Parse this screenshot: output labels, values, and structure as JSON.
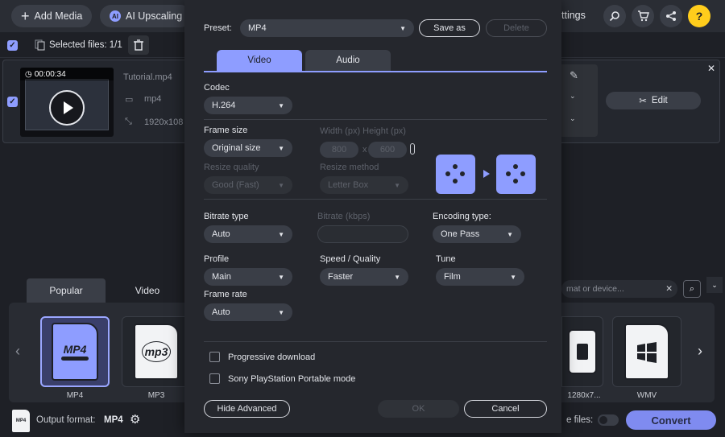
{
  "toolbar": {
    "add_media": "Add Media",
    "ai_upscaling": "AI Upscaling",
    "settings_partial": "ttings"
  },
  "selection": {
    "label": "Selected files: 1/1"
  },
  "file": {
    "duration": "00:00:34",
    "name": "Tutorial.mp4",
    "format": "mp4",
    "resolution": "1920x108",
    "edit_label": "Edit"
  },
  "format_panel": {
    "tabs": [
      "Popular",
      "Video"
    ],
    "search_placeholder": "mat or device...",
    "cards": [
      {
        "label": "MP4",
        "icon_text": "MP4"
      },
      {
        "label": "MP3",
        "icon_text": "mp3"
      },
      {
        "label": "1280x7...",
        "icon_text": ""
      },
      {
        "label": "WMV",
        "icon_text": ""
      }
    ]
  },
  "bottom": {
    "output_label": "Output format:",
    "output_value": "MP4",
    "merge_partial": "e files:",
    "convert_label": "Convert"
  },
  "dialog": {
    "preset_label": "Preset:",
    "preset_value": "MP4",
    "save_as": "Save as",
    "delete": "Delete",
    "tabs": {
      "video": "Video",
      "audio": "Audio"
    },
    "codec_label": "Codec",
    "codec_value": "H.264",
    "frame_size_label": "Frame size",
    "frame_size_value": "Original size",
    "width_height_label": "Width (px)  Height (px)",
    "width_value": "800",
    "x_sep": "x",
    "height_value": "600",
    "resize_quality_label": "Resize quality",
    "resize_quality_value": "Good (Fast)",
    "resize_method_label": "Resize method",
    "resize_method_value": "Letter Box",
    "bitrate_type_label": "Bitrate type",
    "bitrate_type_value": "Auto",
    "bitrate_label": "Bitrate (kbps)",
    "encoding_type_label": "Encoding type:",
    "encoding_type_value": "One Pass",
    "profile_label": "Profile",
    "profile_value": "Main",
    "speed_label": "Speed / Quality",
    "speed_value": "Faster",
    "tune_label": "Tune",
    "tune_value": "Film",
    "frame_rate_label": "Frame rate",
    "frame_rate_value": "Auto",
    "progressive_label": "Progressive download",
    "psp_label": "Sony PlayStation Portable mode",
    "hide_advanced": "Hide Advanced",
    "ok": "OK",
    "cancel": "Cancel"
  },
  "colors": {
    "accent": "#8e9dff",
    "background": "#1e2026",
    "dialog": "#25272d",
    "help": "#ffcd1c"
  }
}
